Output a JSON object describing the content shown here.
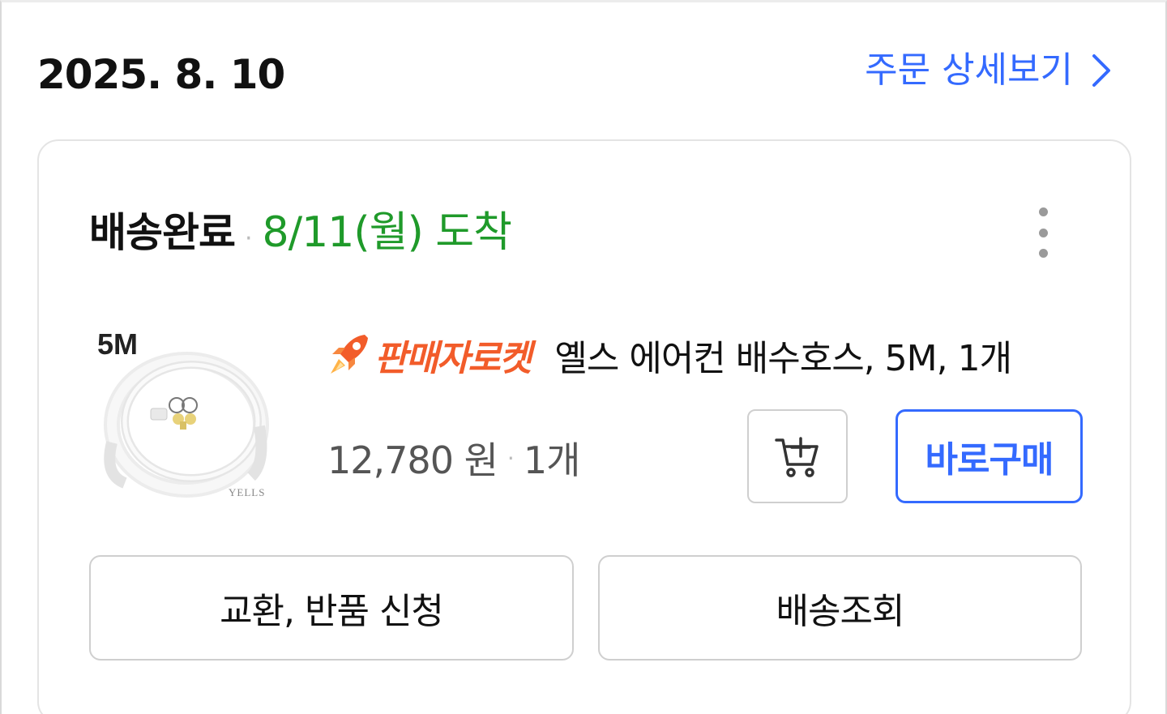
{
  "order": {
    "date": "2025. 8. 10",
    "detail_link_label": "주문 상세보기"
  },
  "delivery": {
    "status": "배송완료",
    "separator": "·",
    "arrival": "8/11(월) 도착"
  },
  "product": {
    "image_size_label": "5M",
    "image_brand_label": "YELLS",
    "seller_badge": "판매자로켓",
    "name": "옐스 에어컨 배수호스, 5M, 1개",
    "price": "12,780 원",
    "price_separator": "·",
    "quantity": "1개"
  },
  "buttons": {
    "buy_now": "바로구매",
    "exchange_return": "교환, 반품 신청",
    "track_delivery": "배송조회"
  },
  "icons": {
    "detail_chevron": "chevron-right-icon",
    "more": "kebab-menu-icon",
    "cart": "add-to-cart-icon",
    "rocket": "rocket-icon"
  },
  "colors": {
    "accent_blue": "#346aff",
    "arrival_green": "#1f9a2a",
    "rocket_orange": "#f25c2a"
  }
}
